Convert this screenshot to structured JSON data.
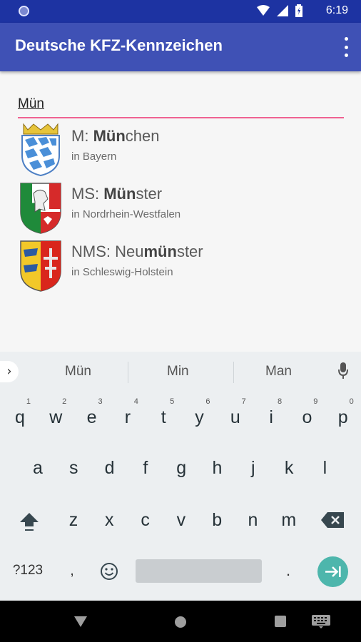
{
  "status_bar": {
    "time": "6:19"
  },
  "app_bar": {
    "title": "Deutsche KFZ-Kennzeichen",
    "menu_icon": "more-vert-icon"
  },
  "search": {
    "value": "Mün",
    "underline_color": "#f06292"
  },
  "results": [
    {
      "code": "M: ",
      "pre": "",
      "match": "Mün",
      "post": "chen",
      "state": "in Bayern",
      "crest": "bayern-crest-icon"
    },
    {
      "code": "MS: ",
      "pre": "",
      "match": "Mün",
      "post": "ster",
      "state": "in Nordrhein-Westfalen",
      "crest": "nrw-crest-icon"
    },
    {
      "code": "NMS: ",
      "pre": "Neu",
      "match": "mün",
      "post": "ster",
      "state": "in Schleswig-Holstein",
      "crest": "schleswig-holstein-crest-icon"
    }
  ],
  "keyboard": {
    "suggestions": [
      "Mün",
      "Min",
      "Man"
    ],
    "row1": [
      "q",
      "w",
      "e",
      "r",
      "t",
      "y",
      "u",
      "i",
      "o",
      "p"
    ],
    "row1_numbers": [
      "1",
      "2",
      "3",
      "4",
      "5",
      "6",
      "7",
      "8",
      "9",
      "0"
    ],
    "row2": [
      "a",
      "s",
      "d",
      "f",
      "g",
      "h",
      "j",
      "k",
      "l"
    ],
    "row3": [
      "z",
      "x",
      "c",
      "v",
      "b",
      "n",
      "m"
    ],
    "symbols_label": "?123",
    "comma": ",",
    "period": "."
  },
  "colors": {
    "primary": "#3f51b5",
    "primary_dark": "#1d33a2",
    "accent": "#f06292",
    "go_button": "#4db6ac"
  }
}
